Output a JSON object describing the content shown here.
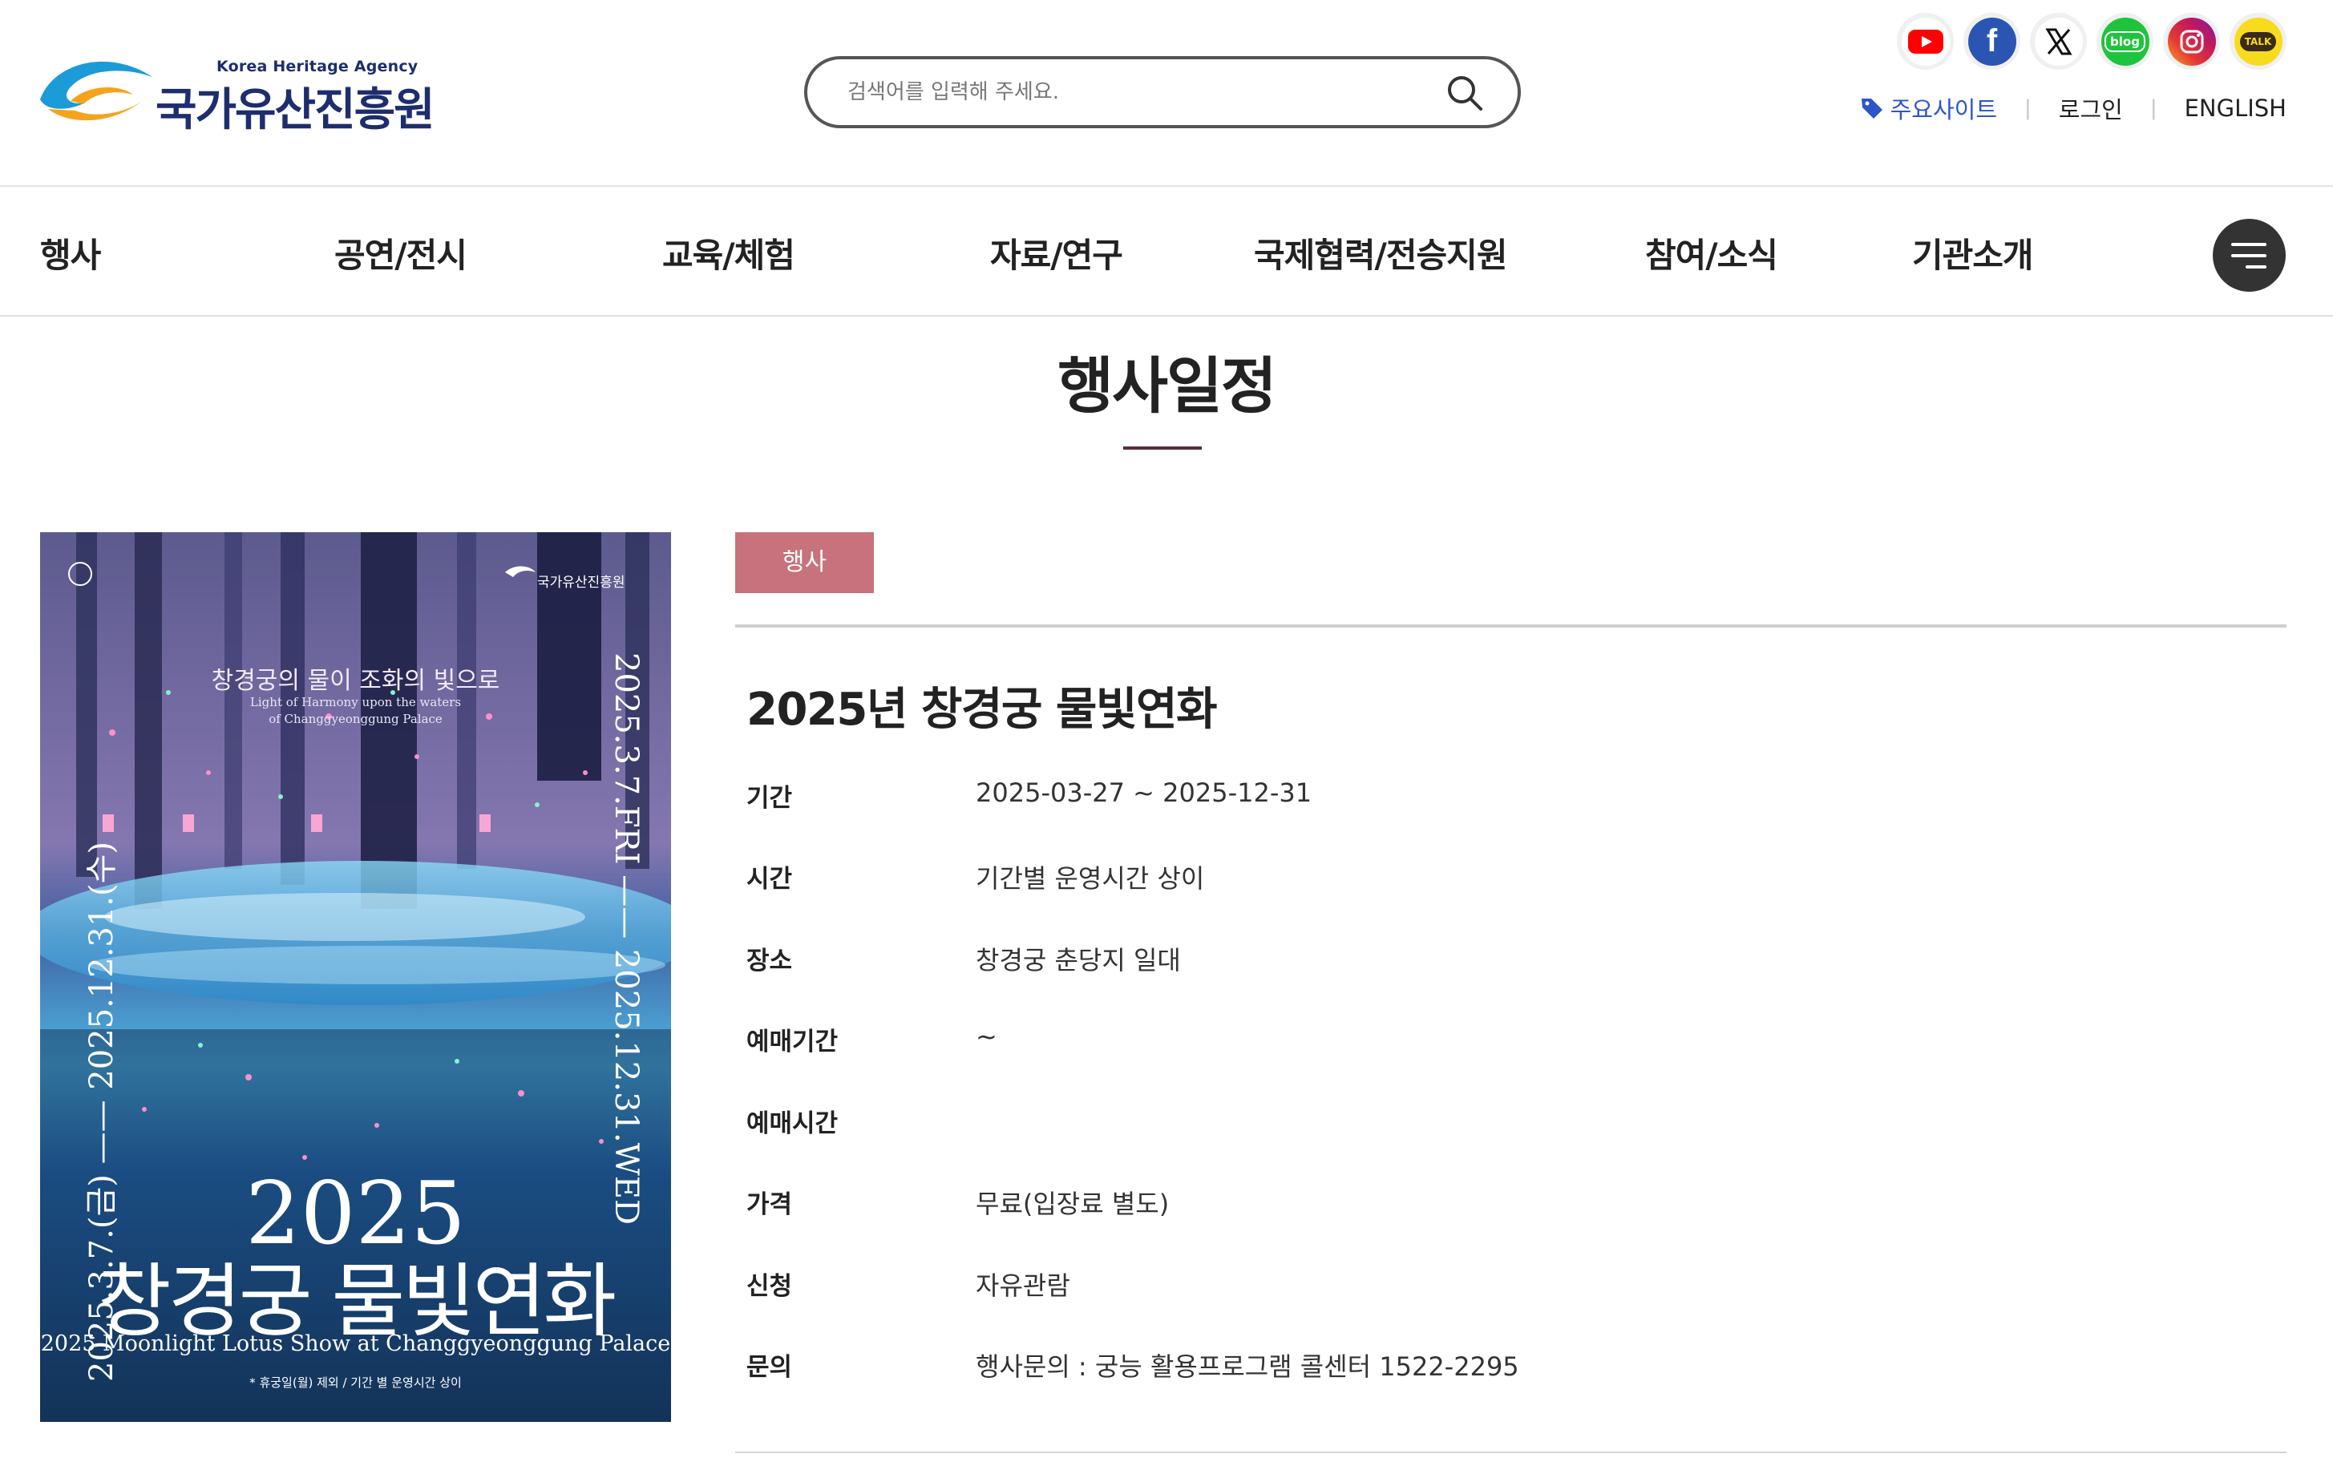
{
  "header": {
    "logo": {
      "en": "Korea Heritage Agency",
      "ko": "국가유산진흥원"
    },
    "search": {
      "placeholder": "검색어를 입력해 주세요."
    },
    "sns": [
      {
        "name": "youtube",
        "color": "#ff0000"
      },
      {
        "name": "facebook",
        "color": "#2a55b3"
      },
      {
        "name": "x",
        "color": "#000000"
      },
      {
        "name": "blog",
        "color": "#1ec43c",
        "label": "blog"
      },
      {
        "name": "instagram",
        "color": "#d62f7f"
      },
      {
        "name": "kakaotalk",
        "color": "#f7dc1e",
        "label": "TALK"
      }
    ],
    "util": {
      "sites": "주요사이트",
      "login": "로그인",
      "english": "ENGLISH"
    }
  },
  "nav": {
    "items": [
      "행사",
      "공연/전시",
      "교육/체험",
      "자료/연구",
      "국제협력/전승지원",
      "참여/소식",
      "기관소개"
    ]
  },
  "page": {
    "title": "행사일정"
  },
  "poster": {
    "title_ko": "창경궁의 물이 조화의 빛으로",
    "title_en_1": "Light of Harmony upon the waters",
    "title_en_2": "of Changgyeonggung Palace",
    "org": "국가유산진흥원",
    "date_left": "2025.3.7.(금) —— 2025.12.31.(수)",
    "date_right": "2025.3.7.FRI —— 2025.12.31.WED",
    "year": "2025",
    "name": "창경궁 물빛연화",
    "subtitle": "2025 Moonlight Lotus Show at Changgyeonggung Palace",
    "note": "* 휴궁일(월) 제외 / 기간 별 운영시간 상이"
  },
  "event": {
    "category": "행사",
    "title": "2025년 창경궁 물빛연화",
    "info": [
      {
        "label": "기간",
        "value": "2025-03-27 ~ 2025-12-31"
      },
      {
        "label": "시간",
        "value": "기간별 운영시간 상이"
      },
      {
        "label": "장소",
        "value": "창경궁 춘당지 일대"
      },
      {
        "label": "예매기간",
        "value": "~"
      },
      {
        "label": "예매시간",
        "value": ""
      },
      {
        "label": "가격",
        "value": "무료(입장료 별도)"
      },
      {
        "label": "신청",
        "value": "자유관람"
      },
      {
        "label": "문의",
        "value": "행사문의 : 궁능 활용프로그램 콜센터 1522-2295"
      }
    ]
  }
}
